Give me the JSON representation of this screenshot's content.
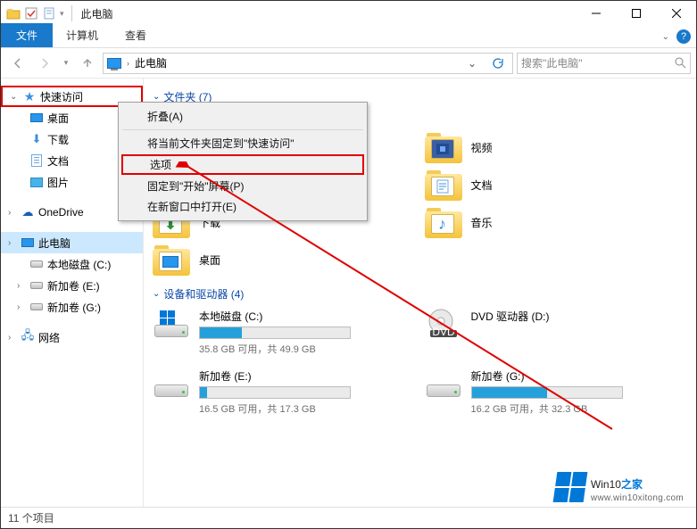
{
  "title": "此电脑",
  "ribbon": {
    "file": "文件",
    "computer": "计算机",
    "view": "查看"
  },
  "addr": {
    "path": "此电脑",
    "search_placeholder": "搜索\"此电脑\""
  },
  "sidebar": {
    "quick": "快速访问",
    "items": [
      "桌面",
      "下载",
      "文档",
      "图片"
    ],
    "onedrive": "OneDrive",
    "thispc": "此电脑",
    "drives": [
      "本地磁盘 (C:)",
      "新加卷 (E:)",
      "新加卷 (G:)"
    ],
    "network": "网络"
  },
  "content": {
    "folders_hdr": "文件夹 (7)",
    "folders": [
      "下载",
      "桌面",
      "视频",
      "文档",
      "音乐"
    ],
    "devices_hdr": "设备和驱动器 (4)",
    "drives": [
      {
        "name": "本地磁盘 (C:)",
        "text": "35.8 GB 可用，共 49.9 GB",
        "pct": 28
      },
      {
        "name": "DVD 驱动器 (D:)",
        "text": "",
        "pct": -1
      },
      {
        "name": "新加卷 (E:)",
        "text": "16.5 GB 可用，共 17.3 GB",
        "pct": 5
      },
      {
        "name": "新加卷 (G:)",
        "text": "16.2 GB 可用，共 32.3 GB",
        "pct": 50
      }
    ]
  },
  "ctx": {
    "collapse": "折叠(A)",
    "pin_quick": "将当前文件夹固定到\"快速访问\"",
    "options": "选项",
    "pin_start": "固定到\"开始\"屏幕(P)",
    "new_window": "在新窗口中打开(E)"
  },
  "status": "11 个项目",
  "watermark": {
    "brand": "Win10",
    "suffix": "之家",
    "url": "www.win10xitong.com"
  }
}
